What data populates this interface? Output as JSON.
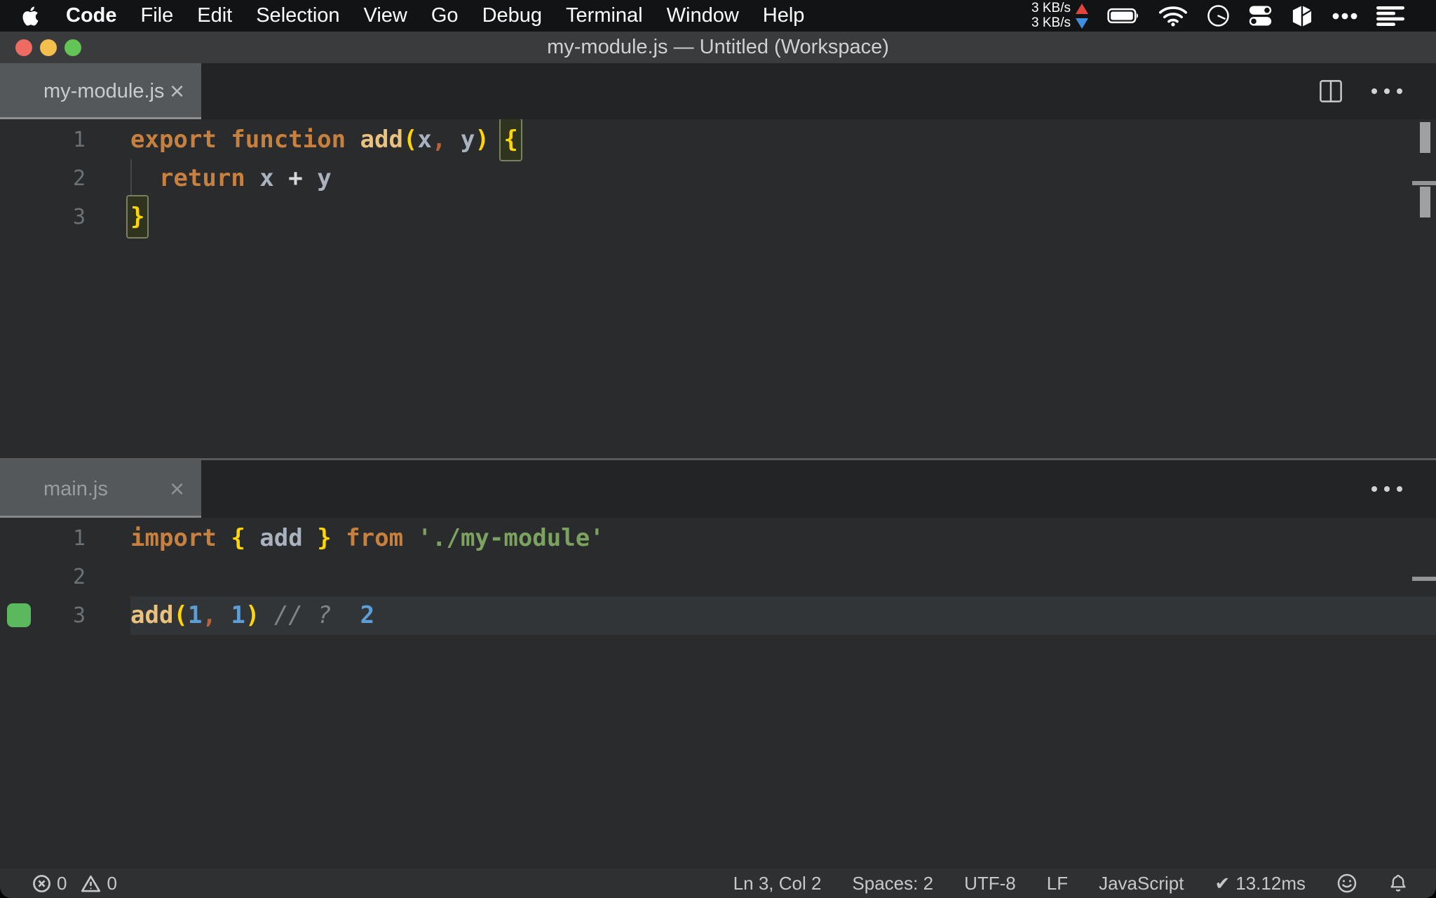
{
  "menu_bar": {
    "items": [
      "Code",
      "File",
      "Edit",
      "Selection",
      "View",
      "Go",
      "Debug",
      "Terminal",
      "Window",
      "Help"
    ],
    "network": {
      "up": "3 KB/s",
      "down": "3 KB/s"
    },
    "status_icons": [
      "apple-icon",
      "upload-arrow-icon",
      "download-arrow-icon",
      "battery-icon",
      "wifi-icon",
      "clock-icon",
      "control-center-icon",
      "box-icon",
      "ellipsis-icon",
      "list-icon"
    ]
  },
  "window": {
    "title": "my-module.js — Untitled (Workspace)"
  },
  "ui": {
    "close_glyph": "×"
  },
  "palette": {
    "kw": "#c8803f",
    "fn": "#eac17e",
    "paren": "#ffd502",
    "var": "#a9b2bd",
    "num": "#5d9ed6",
    "str": "#7ca25f",
    "com": "#808486",
    "op": "#d7d9db",
    "comma": "#b4633a",
    "plain": "#c8cdd2",
    "quokka_green": "#5cb85c",
    "tab_active_bg": "#54585a",
    "editor_bg": "#292b2c"
  },
  "panes": [
    {
      "tab": "my-module.js",
      "lines": [
        {
          "num": "1",
          "tokens": [
            {
              "t": "export function ",
              "s": "kw"
            },
            {
              "t": "add",
              "s": "fn"
            },
            {
              "t": "(",
              "s": "paren"
            },
            {
              "t": "x",
              "s": "var"
            },
            {
              "t": ",",
              "s": "comma"
            },
            {
              "t": " ",
              "s": "plain"
            },
            {
              "t": "y",
              "s": "var"
            },
            {
              "t": ")",
              "s": "paren"
            },
            {
              "t": " ",
              "s": "plain"
            },
            {
              "t": "{",
              "s": "paren",
              "box": true
            }
          ]
        },
        {
          "num": "2",
          "guide": true,
          "tokens": [
            {
              "t": "  ",
              "s": "plain"
            },
            {
              "t": "return",
              "s": "kw"
            },
            {
              "t": " ",
              "s": "plain"
            },
            {
              "t": "x",
              "s": "var"
            },
            {
              "t": " ",
              "s": "plain"
            },
            {
              "t": "+",
              "s": "op"
            },
            {
              "t": " ",
              "s": "plain"
            },
            {
              "t": "y",
              "s": "var"
            }
          ]
        },
        {
          "num": "3",
          "tokens": [
            {
              "t": "}",
              "s": "paren",
              "box": true
            }
          ]
        }
      ]
    },
    {
      "tab": "main.js",
      "lines": [
        {
          "num": "1",
          "tokens": [
            {
              "t": "import",
              "s": "kw"
            },
            {
              "t": " ",
              "s": "plain"
            },
            {
              "t": "{",
              "s": "paren"
            },
            {
              "t": " ",
              "s": "plain"
            },
            {
              "t": "add",
              "s": "var"
            },
            {
              "t": " ",
              "s": "plain"
            },
            {
              "t": "}",
              "s": "paren"
            },
            {
              "t": " ",
              "s": "plain"
            },
            {
              "t": "from",
              "s": "kw"
            },
            {
              "t": " ",
              "s": "plain"
            },
            {
              "t": "'./my-module'",
              "s": "str"
            }
          ]
        },
        {
          "num": "2",
          "tokens": []
        },
        {
          "num": "3",
          "highlight": true,
          "marker": "quokka-covered-marker",
          "tokens": [
            {
              "t": "add",
              "s": "fn"
            },
            {
              "t": "(",
              "s": "paren"
            },
            {
              "t": "1",
              "s": "num"
            },
            {
              "t": ",",
              "s": "comma"
            },
            {
              "t": " ",
              "s": "plain"
            },
            {
              "t": "1",
              "s": "num"
            },
            {
              "t": ")",
              "s": "paren"
            },
            {
              "t": " ",
              "s": "plain"
            },
            {
              "t": "// ?",
              "s": "com"
            },
            {
              "t": "  2",
              "s": "num"
            }
          ]
        }
      ]
    }
  ],
  "status_bar": {
    "errors": "0",
    "warnings": "0",
    "cursor": "Ln 3, Col 2",
    "indentation": "Spaces: 2",
    "encoding": "UTF-8",
    "eol": "LF",
    "language": "JavaScript",
    "quokka_check": "✔",
    "quokka_time": "13.12ms"
  }
}
